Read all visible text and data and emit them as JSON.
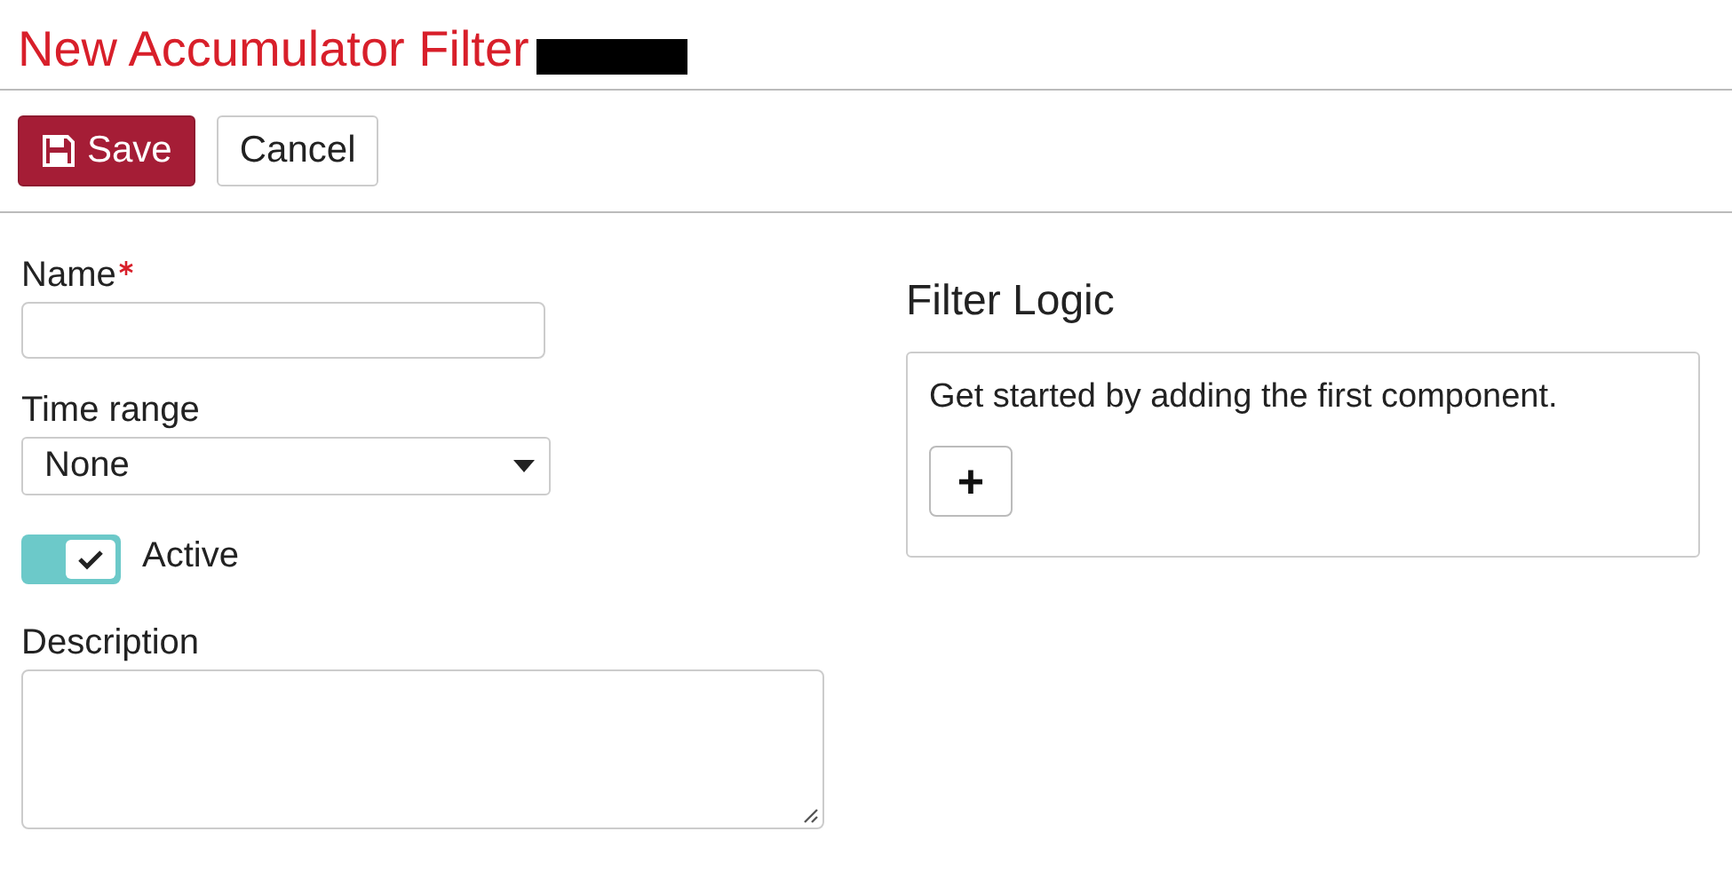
{
  "page": {
    "title": "New Accumulator Filter",
    "redacted": true
  },
  "toolbar": [
    {
      "label": "Save",
      "kind": "primary"
    },
    {
      "label": "Cancel",
      "kind": "default"
    }
  ],
  "form": [
    {
      "kind": "text",
      "label": "Name",
      "required": true
    },
    {
      "kind": "select",
      "label": "Time range",
      "value": "None"
    },
    {
      "kind": "toggle",
      "label": "Active",
      "on": true
    },
    {
      "kind": "textarea",
      "label": "Description"
    }
  ],
  "filter_logic": {
    "heading": "Filter Logic",
    "message": "Get started by adding the first component.",
    "add_button": "+"
  }
}
